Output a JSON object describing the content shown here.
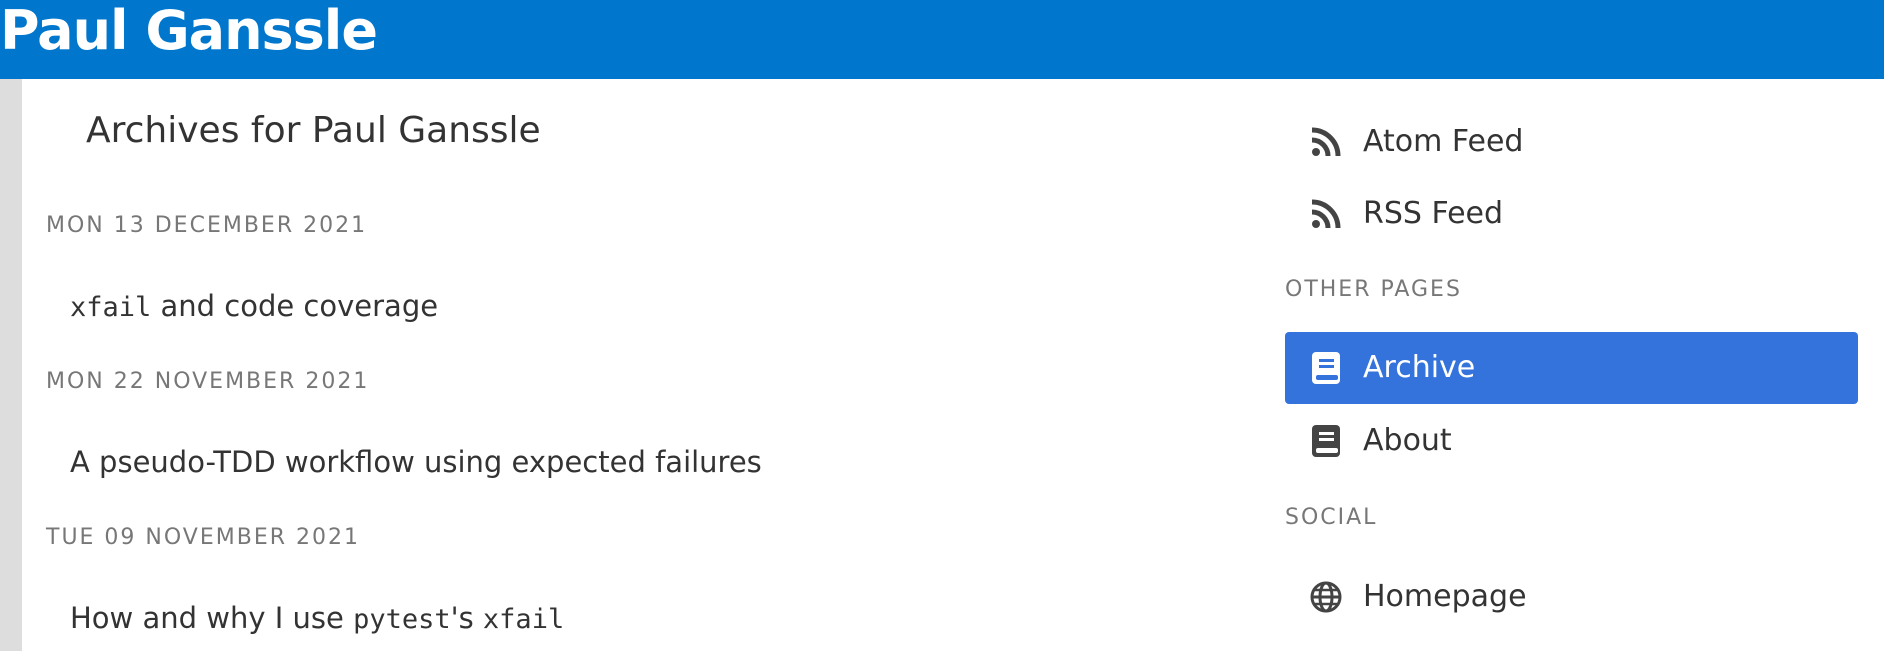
{
  "header": {
    "site_title": "Paul Ganssle",
    "bg_color": "#0077cc"
  },
  "main": {
    "heading": "Archives for Paul Ganssle",
    "entries": [
      {
        "date": "MON 13 DECEMBER 2021",
        "title_code": "xfail",
        "title_text": " and code coverage"
      },
      {
        "date": "MON 22 NOVEMBER 2021",
        "title_text": "A pseudo-TDD workflow using expected failures"
      },
      {
        "date": "TUE 09 NOVEMBER 2021",
        "title_pre": "How and why I use ",
        "title_code1": "pytest",
        "title_mid": "'s ",
        "title_code2": "xfail"
      }
    ]
  },
  "sidebar": {
    "feeds": [
      {
        "label": "Atom Feed",
        "icon": "rss-icon"
      },
      {
        "label": "RSS Feed",
        "icon": "rss-icon"
      }
    ],
    "other_pages_heading": "OTHER PAGES",
    "pages": [
      {
        "label": "Archive",
        "icon": "book-icon",
        "active": true
      },
      {
        "label": "About",
        "icon": "book-icon",
        "active": false
      }
    ],
    "social_heading": "SOCIAL",
    "social": [
      {
        "label": "Homepage",
        "icon": "globe-icon"
      }
    ],
    "active_color": "#3573dc"
  }
}
